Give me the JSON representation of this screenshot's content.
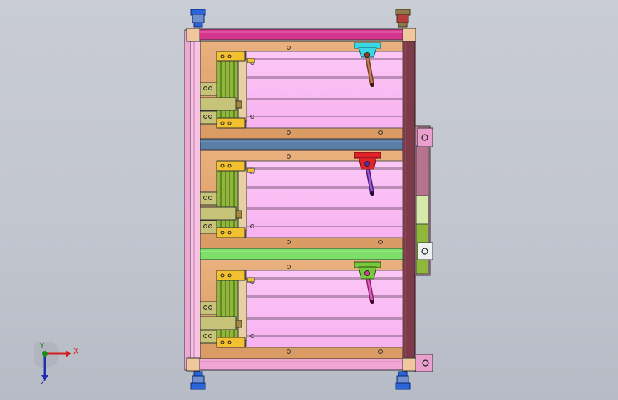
{
  "viewport": {
    "background_top": "#c9ccd4",
    "background_bottom": "#b7bbc5"
  },
  "colors": {
    "frame_magenta": "#d6358f",
    "frame_pink": "#f2a6d8",
    "frame_dark_maroon": "#7d3b4a",
    "plate_tan": "#e3a773",
    "panel_pink": "#fbbdf6",
    "slot_line": "#7a5a7a",
    "divider_blue": "#5b7ea6",
    "divider_green": "#7ddf6a",
    "bracket_yellow": "#f3c12f",
    "rail_green": "#8fb83a",
    "clamp_khaki": "#c7c47a",
    "handle_cyan": "#39d6e6",
    "handle_red": "#e2222a",
    "handle_green": "#78c83e",
    "foot_blue": "#2b63d9",
    "foot_olive": "#8b7b48",
    "side_block_pink": "#e9a0cf"
  },
  "icons": [
    "triad-x-axis-icon",
    "triad-y-axis-icon",
    "triad-z-axis-icon"
  ],
  "triad": {
    "x_label": "X",
    "y_label": "Y",
    "z_label": "Z"
  }
}
